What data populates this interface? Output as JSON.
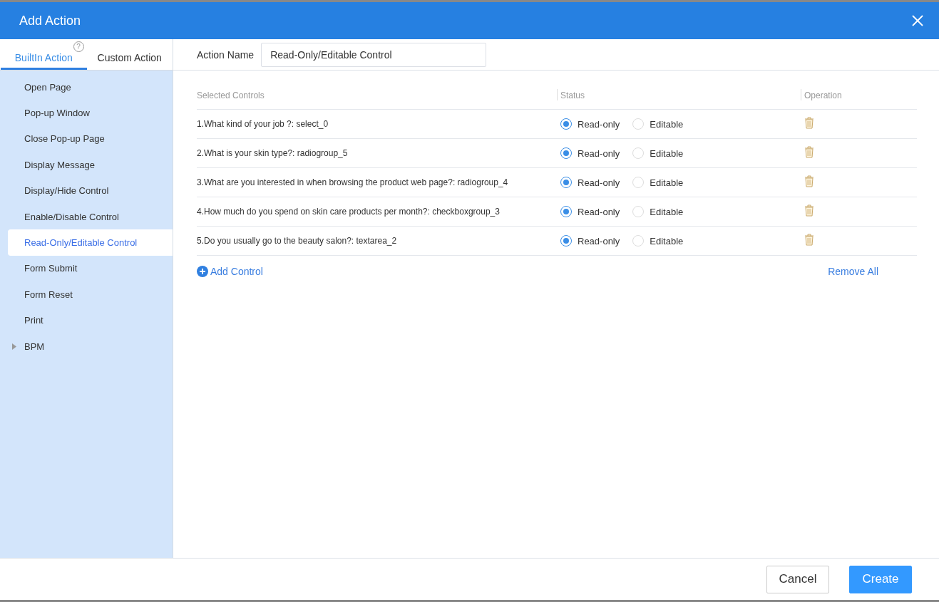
{
  "window": {
    "title": "Add Action"
  },
  "tabs": [
    {
      "label": "BuiltIn Action",
      "selected": true,
      "help": "?"
    },
    {
      "label": "Custom Action",
      "selected": false
    }
  ],
  "sidebar": {
    "items": [
      {
        "label": "Open Page",
        "selected": false
      },
      {
        "label": "Pop-up Window",
        "selected": false
      },
      {
        "label": "Close Pop-up Page",
        "selected": false
      },
      {
        "label": "Display Message",
        "selected": false
      },
      {
        "label": "Display/Hide Control",
        "selected": false
      },
      {
        "label": "Enable/Disable Control",
        "selected": false
      },
      {
        "label": "Read-Only/Editable Control",
        "selected": true
      },
      {
        "label": "Form Submit",
        "selected": false
      },
      {
        "label": "Form Reset",
        "selected": false
      },
      {
        "label": "Print",
        "selected": false
      },
      {
        "label": "BPM",
        "selected": false,
        "expanded": false
      }
    ]
  },
  "action_name": {
    "label": "Action Name",
    "value": "Read-Only/Editable Control"
  },
  "table": {
    "columns": [
      "Selected Controls",
      "Status",
      "Operation"
    ],
    "rows": [
      {
        "control": "1.What kind of your job ?: select_0",
        "options": [
          {
            "label": "Read-only",
            "selected": true
          },
          {
            "label": "Editable",
            "selected": false
          }
        ]
      },
      {
        "control": "2.What is your skin type?: radiogroup_5",
        "options": [
          {
            "label": "Read-only",
            "selected": true
          },
          {
            "label": "Editable",
            "selected": false
          }
        ]
      },
      {
        "control": "3.What are you interested in when browsing the product web page?: radiogroup_4",
        "options": [
          {
            "label": "Read-only",
            "selected": true
          },
          {
            "label": "Editable",
            "selected": false
          }
        ]
      },
      {
        "control": "4.How much do you spend on skin care products per month?: checkboxgroup_3",
        "options": [
          {
            "label": "Read-only",
            "selected": true
          },
          {
            "label": "Editable",
            "selected": false
          }
        ]
      },
      {
        "control": "5.Do you usually go to the beauty salon?: textarea_2",
        "options": [
          {
            "label": "Read-only",
            "selected": true
          },
          {
            "label": "Editable",
            "selected": false
          }
        ]
      }
    ]
  },
  "add_control": "Add Control",
  "remove_all": "Remove All",
  "buttons": [
    {
      "label": "Cancel",
      "kind": "secondary"
    },
    {
      "label": "Create",
      "kind": "primary"
    }
  ]
}
